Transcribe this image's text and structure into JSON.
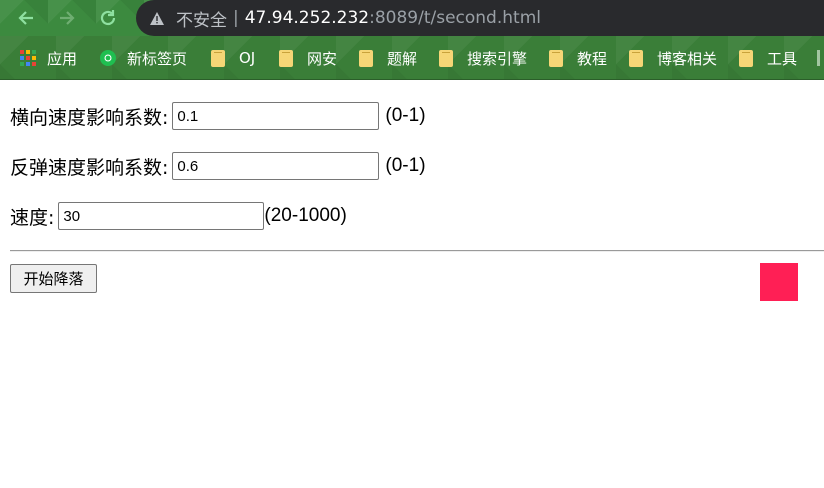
{
  "browser": {
    "address": {
      "security_label": "不安全",
      "separator": "|",
      "host": "47.94.252.232",
      "path": ":8089/t/second.html"
    },
    "bookmarks": [
      {
        "label": "应用",
        "icon": "apps-grid-icon"
      },
      {
        "label": "新标签页",
        "icon": "chrome-icon"
      },
      {
        "label": "OJ",
        "icon": "folder-icon"
      },
      {
        "label": "网安",
        "icon": "folder-icon"
      },
      {
        "label": "题解",
        "icon": "folder-icon"
      },
      {
        "label": "搜索引擎",
        "icon": "folder-icon"
      },
      {
        "label": "教程",
        "icon": "folder-icon"
      },
      {
        "label": "博客相关",
        "icon": "folder-icon"
      },
      {
        "label": "工具",
        "icon": "folder-icon"
      }
    ],
    "colors": {
      "toolbar_green": "#3c8a3f",
      "omnibox_bg": "#292a2d"
    }
  },
  "form": {
    "horizontal": {
      "label": "横向速度影响系数:",
      "value": "0.1",
      "range": "(0-1)"
    },
    "bounce": {
      "label": "反弹速度影响系数:",
      "value": "0.6",
      "range": "(0-1)"
    },
    "speed": {
      "label": "速度:",
      "value": "30",
      "range": "(20-1000)"
    }
  },
  "actions": {
    "start_label": "开始降落"
  },
  "ball": {
    "color": "#ff1f55"
  }
}
